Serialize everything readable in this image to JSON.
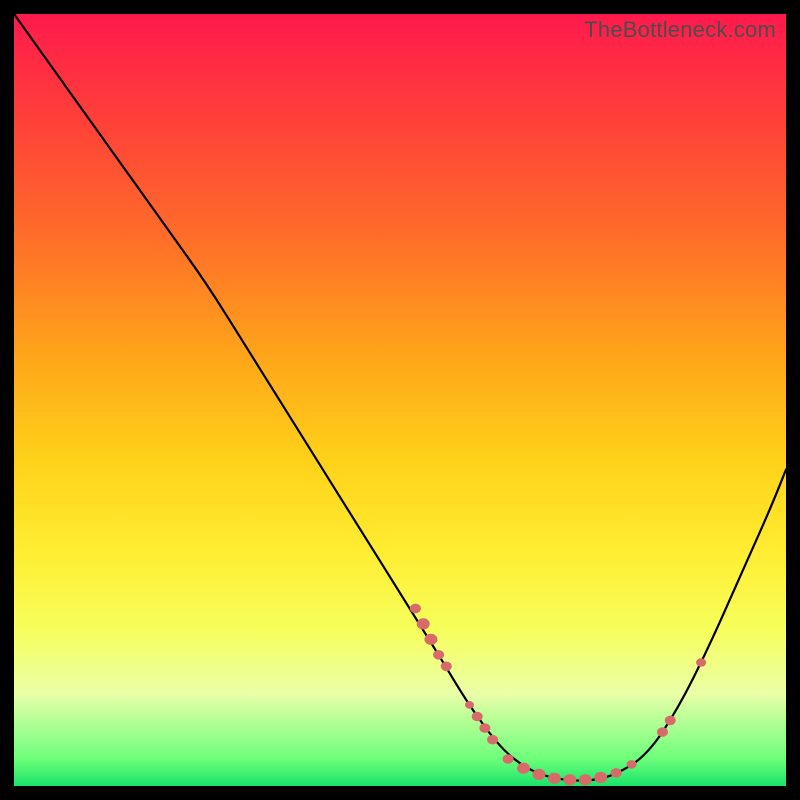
{
  "watermark": "TheBottleneck.com",
  "chart_data": {
    "type": "line",
    "title": "",
    "xlabel": "",
    "ylabel": "",
    "xlim": [
      0,
      100
    ],
    "ylim": [
      0,
      100
    ],
    "series": [
      {
        "name": "bottleneck-curve",
        "x": [
          0,
          5,
          10,
          15,
          20,
          25,
          30,
          35,
          40,
          45,
          50,
          55,
          58,
          60,
          63,
          66,
          69,
          72,
          75,
          78,
          82,
          86,
          90,
          94,
          98,
          100
        ],
        "y": [
          100,
          93,
          86,
          79,
          72,
          65,
          57,
          49,
          41,
          33,
          25,
          17,
          12,
          9,
          5,
          2.5,
          1.2,
          0.7,
          0.7,
          1.5,
          4,
          10,
          18,
          27,
          36,
          41
        ]
      }
    ],
    "markers": {
      "name": "highlight-dots",
      "color": "#d96a6a",
      "points": [
        {
          "x": 52,
          "y": 23,
          "r": 5
        },
        {
          "x": 53,
          "y": 21,
          "r": 6
        },
        {
          "x": 54,
          "y": 19,
          "r": 6
        },
        {
          "x": 55,
          "y": 17,
          "r": 5
        },
        {
          "x": 56,
          "y": 15.5,
          "r": 5
        },
        {
          "x": 59,
          "y": 10.5,
          "r": 4
        },
        {
          "x": 60,
          "y": 9,
          "r": 5
        },
        {
          "x": 61,
          "y": 7.5,
          "r": 5
        },
        {
          "x": 62,
          "y": 6,
          "r": 5
        },
        {
          "x": 64,
          "y": 3.5,
          "r": 5
        },
        {
          "x": 66,
          "y": 2.3,
          "r": 6
        },
        {
          "x": 68,
          "y": 1.5,
          "r": 6
        },
        {
          "x": 70,
          "y": 1.0,
          "r": 6
        },
        {
          "x": 72,
          "y": 0.8,
          "r": 6
        },
        {
          "x": 74,
          "y": 0.8,
          "r": 6
        },
        {
          "x": 76,
          "y": 1.1,
          "r": 6
        },
        {
          "x": 78,
          "y": 1.7,
          "r": 5
        },
        {
          "x": 80,
          "y": 2.8,
          "r": 4.5
        },
        {
          "x": 84,
          "y": 7,
          "r": 5
        },
        {
          "x": 85,
          "y": 8.5,
          "r": 5
        },
        {
          "x": 89,
          "y": 16,
          "r": 4.5
        }
      ]
    }
  }
}
